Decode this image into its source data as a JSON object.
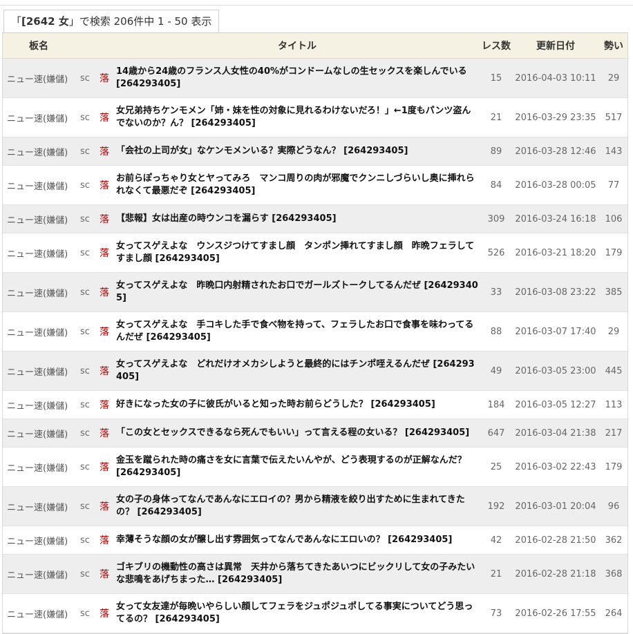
{
  "search": {
    "open_quote": "「",
    "keyword": "[2642 女",
    "close_quote": "」",
    "summary": "で検索 206件中 1 - 50 表示"
  },
  "table": {
    "headers": {
      "board": "板名",
      "title": "タイトル",
      "res": "レス数",
      "updated": "更新日付",
      "force": "勢い"
    },
    "rows": [
      {
        "board": "ニュー速(嫌儲)",
        "sc": "sc",
        "ochi": "落",
        "title": "14歳から24歳のフランス人女性の40%がコンドームなしの生セックスを楽しんでいる [264293405]",
        "res": "15",
        "date": "2016-04-03 10:11",
        "force": "29"
      },
      {
        "board": "ニュー速(嫌儲)",
        "sc": "sc",
        "ochi": "落",
        "title": "女兄弟持ちケンモメン「姉・妹を性の対象に見れるわけないだろ！」←1度もパンツ盗んでないのか？ん？ [264293405]",
        "res": "21",
        "date": "2016-03-29 23:35",
        "force": "517"
      },
      {
        "board": "ニュー速(嫌儲)",
        "sc": "sc",
        "ochi": "落",
        "title": "「会社の上司が女」なケンモメンいる？実際どうなん？ [264293405]",
        "res": "89",
        "date": "2016-03-28 12:46",
        "force": "143"
      },
      {
        "board": "ニュー速(嫌儲)",
        "sc": "sc",
        "ochi": "落",
        "title": "お前らぽっちゃり女とヤってみろ　マンコ周りの肉が邪魔でクンニしづらいし奥に挿れられなくて最悪だぞ [264293405]",
        "res": "84",
        "date": "2016-03-28 00:05",
        "force": "77"
      },
      {
        "board": "ニュー速(嫌儲)",
        "sc": "sc",
        "ochi": "落",
        "title": "【悲報】女は出産の時ウンコを漏らす [264293405]",
        "res": "309",
        "date": "2016-03-24 16:18",
        "force": "106"
      },
      {
        "board": "ニュー速(嫌儲)",
        "sc": "sc",
        "ochi": "落",
        "title": "女ってスゲえよな　ウンスジつけてすまし顔　タンポン挿れてすまし顔　昨晩フェラしてすまし顔 [264293405]",
        "res": "526",
        "date": "2016-03-21 18:20",
        "force": "179"
      },
      {
        "board": "ニュー速(嫌儲)",
        "sc": "sc",
        "ochi": "落",
        "title": "女ってスゲえよな　昨晩口内射精されたお口でガールズトークしてるんだぜ [264293405]",
        "res": "33",
        "date": "2016-03-08 23:22",
        "force": "385"
      },
      {
        "board": "ニュー速(嫌儲)",
        "sc": "sc",
        "ochi": "落",
        "title": "女ってスゲえよな　手コキした手で食べ物を持って、フェラしたお口で食事を味わってるんだぜ [264293405]",
        "res": "88",
        "date": "2016-03-07 17:40",
        "force": "29"
      },
      {
        "board": "ニュー速(嫌儲)",
        "sc": "sc",
        "ochi": "落",
        "title": "女ってスゲえよな　どれだけオメカシしようと最終的にはチンポ咥えるんだぜ [264293405]",
        "res": "49",
        "date": "2016-03-05 23:00",
        "force": "445"
      },
      {
        "board": "ニュー速(嫌儲)",
        "sc": "sc",
        "ochi": "落",
        "title": "好きになった女の子に彼氏がいると知った時お前らどうした？ [264293405]",
        "res": "184",
        "date": "2016-03-05 12:27",
        "force": "113"
      },
      {
        "board": "ニュー速(嫌儲)",
        "sc": "sc",
        "ochi": "落",
        "title": "「この女とセックスできるなら死んでもいい」って言える程の女いる？ [264293405]",
        "res": "647",
        "date": "2016-03-04 21:38",
        "force": "217"
      },
      {
        "board": "ニュー速(嫌儲)",
        "sc": "sc",
        "ochi": "落",
        "title": "金玉を蹴られた時の痛さを女に言葉で伝えたいんやが、どう表現するのが正解なんだ？ [264293405]",
        "res": "25",
        "date": "2016-03-02 22:43",
        "force": "179"
      },
      {
        "board": "ニュー速(嫌儲)",
        "sc": "sc",
        "ochi": "落",
        "title": "女の子の身体ってなんであんなにエロイの？男から精液を絞り出すために生まれてきたの？ [264293405]",
        "res": "192",
        "date": "2016-03-01 20:04",
        "force": "96"
      },
      {
        "board": "ニュー速(嫌儲)",
        "sc": "sc",
        "ochi": "落",
        "title": "幸薄そうな顔の女が醸し出す雰囲気ってなんであんなにエロいの？ [264293405]",
        "res": "42",
        "date": "2016-02-28 21:50",
        "force": "362"
      },
      {
        "board": "ニュー速(嫌儲)",
        "sc": "sc",
        "ochi": "落",
        "title": "ゴキブリの機動性の高さは異常　天井から落ちてきたあいつにビックリして女の子みたいな悲鳴をあげちまった… [264293405]",
        "res": "21",
        "date": "2016-02-28 21:18",
        "force": "368"
      },
      {
        "board": "ニュー速(嫌儲)",
        "sc": "sc",
        "ochi": "落",
        "title": "女って女友達が毎晩いやらしい顔してフェラをジュポジュポしてる事実についてどう思ってるの？ [264293405]",
        "res": "73",
        "date": "2016-02-26 17:55",
        "force": "264"
      }
    ]
  }
}
